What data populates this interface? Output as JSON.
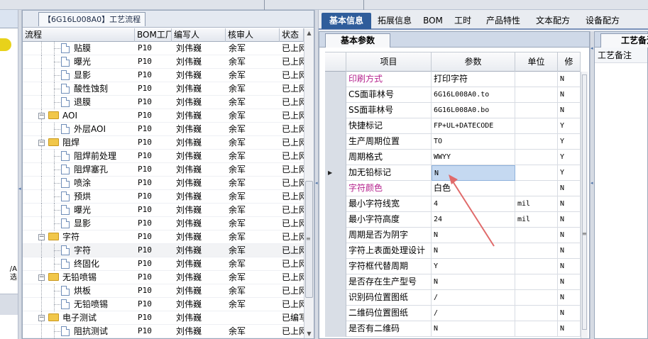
{
  "left_panel": {
    "cut_label_line1": "/A",
    "cut_label_line2": "选"
  },
  "flow_panel": {
    "title": "【6G16L008A0】工艺流程",
    "columns": [
      "流程",
      "BOM工厂",
      "编写人",
      "核审人",
      "状态"
    ],
    "rows": [
      {
        "kind": "doc",
        "name": "贴膜",
        "bom": "P10",
        "author": "刘伟巍",
        "reviewer": "余军",
        "status": "已上网"
      },
      {
        "kind": "doc",
        "name": "曝光",
        "bom": "P10",
        "author": "刘伟巍",
        "reviewer": "余军",
        "status": "已上网"
      },
      {
        "kind": "doc",
        "name": "显影",
        "bom": "P10",
        "author": "刘伟巍",
        "reviewer": "余军",
        "status": "已上网"
      },
      {
        "kind": "doc",
        "name": "酸性蚀刻",
        "bom": "P10",
        "author": "刘伟巍",
        "reviewer": "余军",
        "status": "已上网"
      },
      {
        "kind": "doc",
        "name": "退膜",
        "bom": "P10",
        "author": "刘伟巍",
        "reviewer": "余军",
        "status": "已上网"
      },
      {
        "kind": "folder",
        "name": "AOI",
        "bom": "P10",
        "author": "刘伟巍",
        "reviewer": "余军",
        "status": "已上网"
      },
      {
        "kind": "doc",
        "name": "外层AOI",
        "bom": "P10",
        "author": "刘伟巍",
        "reviewer": "余军",
        "status": "已上网"
      },
      {
        "kind": "folder",
        "name": "阻焊",
        "bom": "P10",
        "author": "刘伟巍",
        "reviewer": "余军",
        "status": "已上网"
      },
      {
        "kind": "doc",
        "name": "阻焊前处理",
        "bom": "P10",
        "author": "刘伟巍",
        "reviewer": "余军",
        "status": "已上网"
      },
      {
        "kind": "doc",
        "name": "阻焊塞孔",
        "bom": "P10",
        "author": "刘伟巍",
        "reviewer": "余军",
        "status": "已上网"
      },
      {
        "kind": "doc",
        "name": "喷涂",
        "bom": "P10",
        "author": "刘伟巍",
        "reviewer": "余军",
        "status": "已上网"
      },
      {
        "kind": "doc",
        "name": "预烘",
        "bom": "P10",
        "author": "刘伟巍",
        "reviewer": "余军",
        "status": "已上网"
      },
      {
        "kind": "doc",
        "name": "曝光",
        "bom": "P10",
        "author": "刘伟巍",
        "reviewer": "余军",
        "status": "已上网"
      },
      {
        "kind": "doc",
        "name": "显影",
        "bom": "P10",
        "author": "刘伟巍",
        "reviewer": "余军",
        "status": "已上网"
      },
      {
        "kind": "folder",
        "name": "字符",
        "bom": "P10",
        "author": "刘伟巍",
        "reviewer": "余军",
        "status": "已上网"
      },
      {
        "kind": "doc",
        "name": "字符",
        "bom": "P10",
        "author": "刘伟巍",
        "reviewer": "余军",
        "status": "已上网",
        "selected": true
      },
      {
        "kind": "doc",
        "name": "终固化",
        "bom": "P10",
        "author": "刘伟巍",
        "reviewer": "余军",
        "status": "已上网"
      },
      {
        "kind": "folder",
        "name": "无铅喷锡",
        "bom": "P10",
        "author": "刘伟巍",
        "reviewer": "余军",
        "status": "已上网"
      },
      {
        "kind": "doc",
        "name": "烘板",
        "bom": "P10",
        "author": "刘伟巍",
        "reviewer": "余军",
        "status": "已上网"
      },
      {
        "kind": "doc",
        "name": "无铅喷锡",
        "bom": "P10",
        "author": "刘伟巍",
        "reviewer": "余军",
        "status": "已上网"
      },
      {
        "kind": "folder",
        "name": "电子测试",
        "bom": "P10",
        "author": "刘伟巍",
        "reviewer": "",
        "status": "已编写"
      },
      {
        "kind": "doc",
        "name": "阻抗测试",
        "bom": "P10",
        "author": "刘伟巍",
        "reviewer": "余军",
        "status": "已上网"
      }
    ]
  },
  "tabs": [
    "基本信息",
    "拓展信息",
    "BOM",
    "工时",
    "产品特性",
    "文本配方",
    "设备配方"
  ],
  "basic_panel": {
    "subtab": "基本参数",
    "columns": [
      "项目",
      "参数",
      "单位",
      "修"
    ],
    "rows": [
      {
        "item": "印刷方式",
        "param": "打印字符",
        "unit": "",
        "mod": "N",
        "pink": true,
        "param_cjk": true
      },
      {
        "item": "CS面菲林号",
        "param": "6G16L008A0.to",
        "unit": "",
        "mod": "N"
      },
      {
        "item": "SS面菲林号",
        "param": "6G16L008A0.bo",
        "unit": "",
        "mod": "N"
      },
      {
        "item": "快捷标记",
        "param": "FP+UL+DATECODE",
        "unit": "",
        "mod": "Y"
      },
      {
        "item": "生产周期位置",
        "param": "TO",
        "unit": "",
        "mod": "Y"
      },
      {
        "item": "周期格式",
        "param": "WWYY",
        "unit": "",
        "mod": "Y"
      },
      {
        "item": "加无铅标记",
        "param": "N",
        "unit": "",
        "mod": "Y",
        "selected": true
      },
      {
        "item": "字符颜色",
        "param": "白色",
        "unit": "",
        "mod": "N",
        "pink": true,
        "param_cjk": true
      },
      {
        "item": "最小字符线宽",
        "param": "4",
        "unit": "mil",
        "mod": "N"
      },
      {
        "item": "最小字符高度",
        "param": "24",
        "unit": "mil",
        "mod": "N"
      },
      {
        "item": "周期是否为阴字",
        "param": "N",
        "unit": "",
        "mod": "N"
      },
      {
        "item": "字符上表面处理设计",
        "param": "N",
        "unit": "",
        "mod": "N"
      },
      {
        "item": "字符框代替周期",
        "param": "Y",
        "unit": "",
        "mod": "N"
      },
      {
        "item": "是否存在生产型号",
        "param": "N",
        "unit": "",
        "mod": "N"
      },
      {
        "item": "识别码位置图纸",
        "param": "/",
        "unit": "",
        "mod": "N"
      },
      {
        "item": "二维码位置图纸",
        "param": "/",
        "unit": "",
        "mod": "N"
      },
      {
        "item": "是否有二维码",
        "param": "N",
        "unit": "",
        "mod": "N"
      }
    ]
  },
  "notes_panel": {
    "tab": "工艺备注",
    "row_label": "工艺备注"
  },
  "colors": {
    "tab_active": "#2f5d9b",
    "pink_label": "#b5238e",
    "arrow": "#e06a6a"
  }
}
